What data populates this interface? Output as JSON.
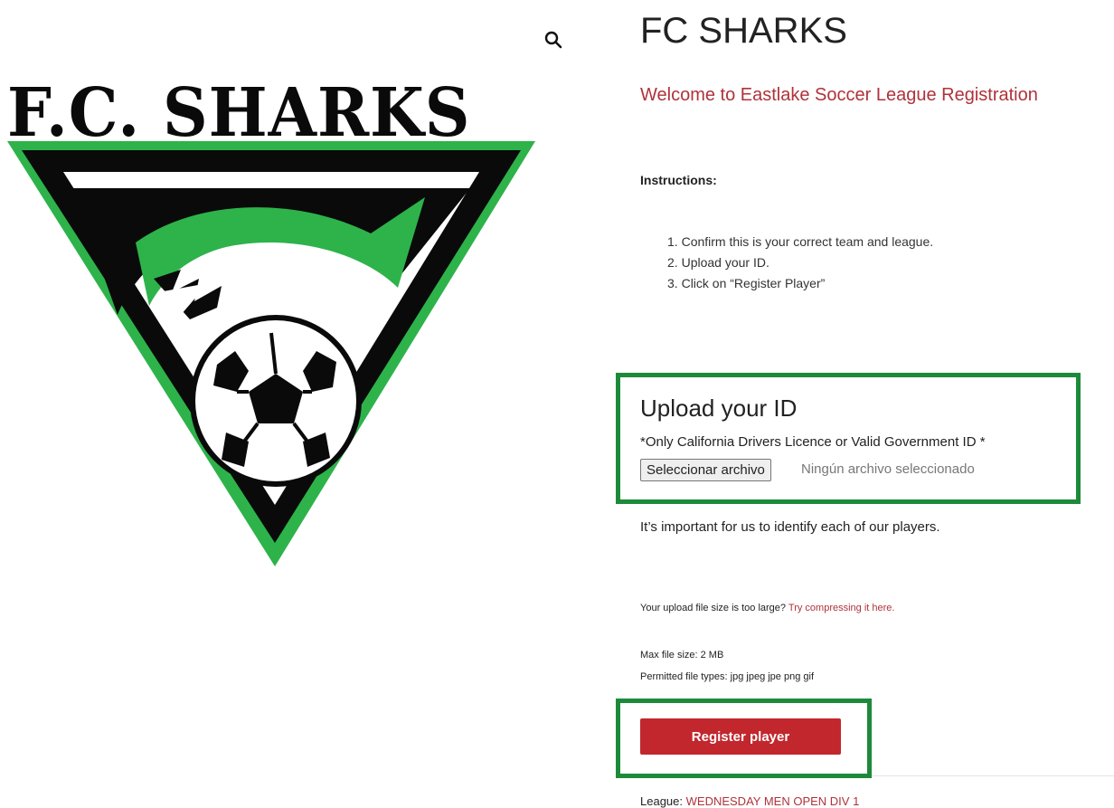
{
  "logo": {
    "text": "F.C. SHARKS"
  },
  "icons": {
    "zoom": "search-icon"
  },
  "header": {
    "title": "FC SHARKS",
    "subtitle": "Welcome to Eastlake Soccer League Registration"
  },
  "instructions": {
    "label": "Instructions:",
    "steps": [
      "Confirm this is your correct team and league.",
      "Upload your ID.",
      "Click on “Register Player”"
    ]
  },
  "upload": {
    "title": "Upload your ID",
    "note": "*Only California Drivers Licence or Valid Government ID *",
    "file_button": "Seleccionar archivo",
    "file_status": "Ningún archivo seleccionado"
  },
  "identify_text": "It’s important for us to identify each of our players.",
  "size_note": {
    "text": "Your upload file size is too large?",
    "link": "Try compressing it here."
  },
  "limits": {
    "max_size": "Max file size: 2 MB",
    "file_types": "Permitted file types: jpg jpeg jpe png gif"
  },
  "register_button": "Register player",
  "league": {
    "label": "League:",
    "value": "WEDNESDAY MEN OPEN DIV 1"
  },
  "colors": {
    "accent_red": "#b0323a",
    "button_red": "#c1272d",
    "highlight_green": "#1d8a3a",
    "logo_green": "#2db34a"
  }
}
